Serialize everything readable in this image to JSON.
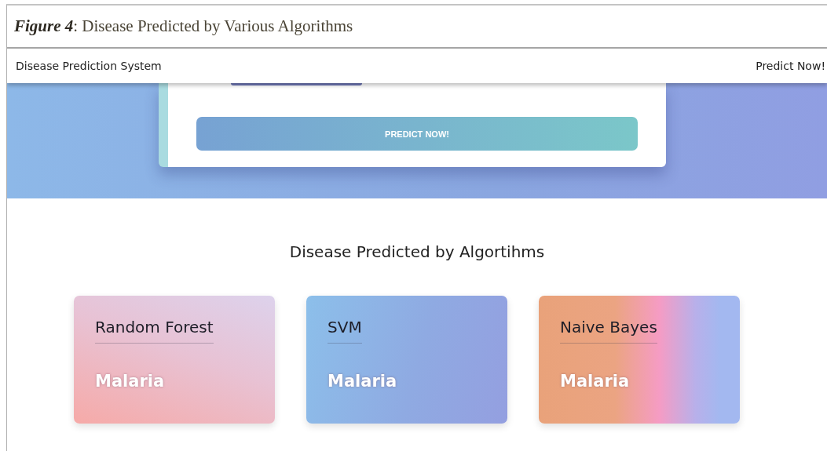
{
  "caption": "*Figure 4*: Disease Predicted by Various Algorithms",
  "navbar": {
    "brand": "Disease Prediction System",
    "link": "Predict Now!"
  },
  "hero": {
    "button": "PREDICT NOW!"
  },
  "section": {
    "title": "Disease Predicted by Algortihms",
    "cards": [
      {
        "kind": "rose",
        "algorithm": "Random Forest",
        "result": "Malaria"
      },
      {
        "kind": "blue",
        "algorithm": "SVM",
        "result": "Malaria"
      },
      {
        "kind": "peach",
        "algorithm": "Naive Bayes",
        "result": "Malaria"
      }
    ]
  }
}
